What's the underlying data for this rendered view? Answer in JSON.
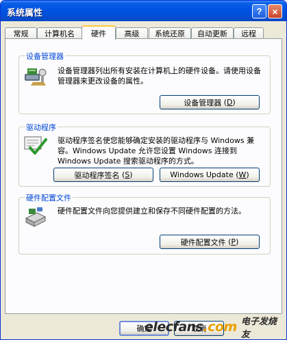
{
  "window": {
    "title": "系统属性",
    "help_label": "?",
    "close_label": "×"
  },
  "tabs": [
    {
      "label": "常规"
    },
    {
      "label": "计算机名"
    },
    {
      "label": "硬件"
    },
    {
      "label": "高级"
    },
    {
      "label": "系统还原"
    },
    {
      "label": "自动更新"
    },
    {
      "label": "远程"
    }
  ],
  "active_tab": "硬件",
  "device_manager": {
    "title": "设备管理器",
    "description": "设备管理器列出所有安装在计算机上的硬件设备。请使用设备管理器来更改设备的属性。",
    "button_label": "设备管理器",
    "button_hotkey": "D",
    "icon": "device-manager-icon"
  },
  "drivers": {
    "title": "驱动程序",
    "description": "驱动程序签名使您能够确定安装的驱动程序与 Windows 兼容。Windows Update 允许您设置 Windows 连接到 Windows Update 搜索驱动程序的方式。",
    "signing_button_label": "驱动程序签名",
    "signing_button_hotkey": "S",
    "update_button_label": "Windows Update",
    "update_button_hotkey": "W",
    "icon": "driver-signing-icon"
  },
  "hardware_profiles": {
    "title": "硬件配置文件",
    "description": "硬件配置文件向您提供建立和保存不同硬件配置的方法。",
    "button_label": "硬件配置文件",
    "button_hotkey": "P",
    "icon": "hardware-profile-icon"
  },
  "footer": {
    "ok_label": "确定",
    "cancel_label": "取消"
  },
  "watermark": {
    "logo": "elecfans",
    "logo_dot": ".com",
    "cn": "电子发烧友"
  },
  "colors": {
    "titlebar": "#0054e3",
    "group_title": "#0046d5",
    "dialog_bg": "#ece9d8",
    "active_tab_accent": "#ffc83c"
  }
}
